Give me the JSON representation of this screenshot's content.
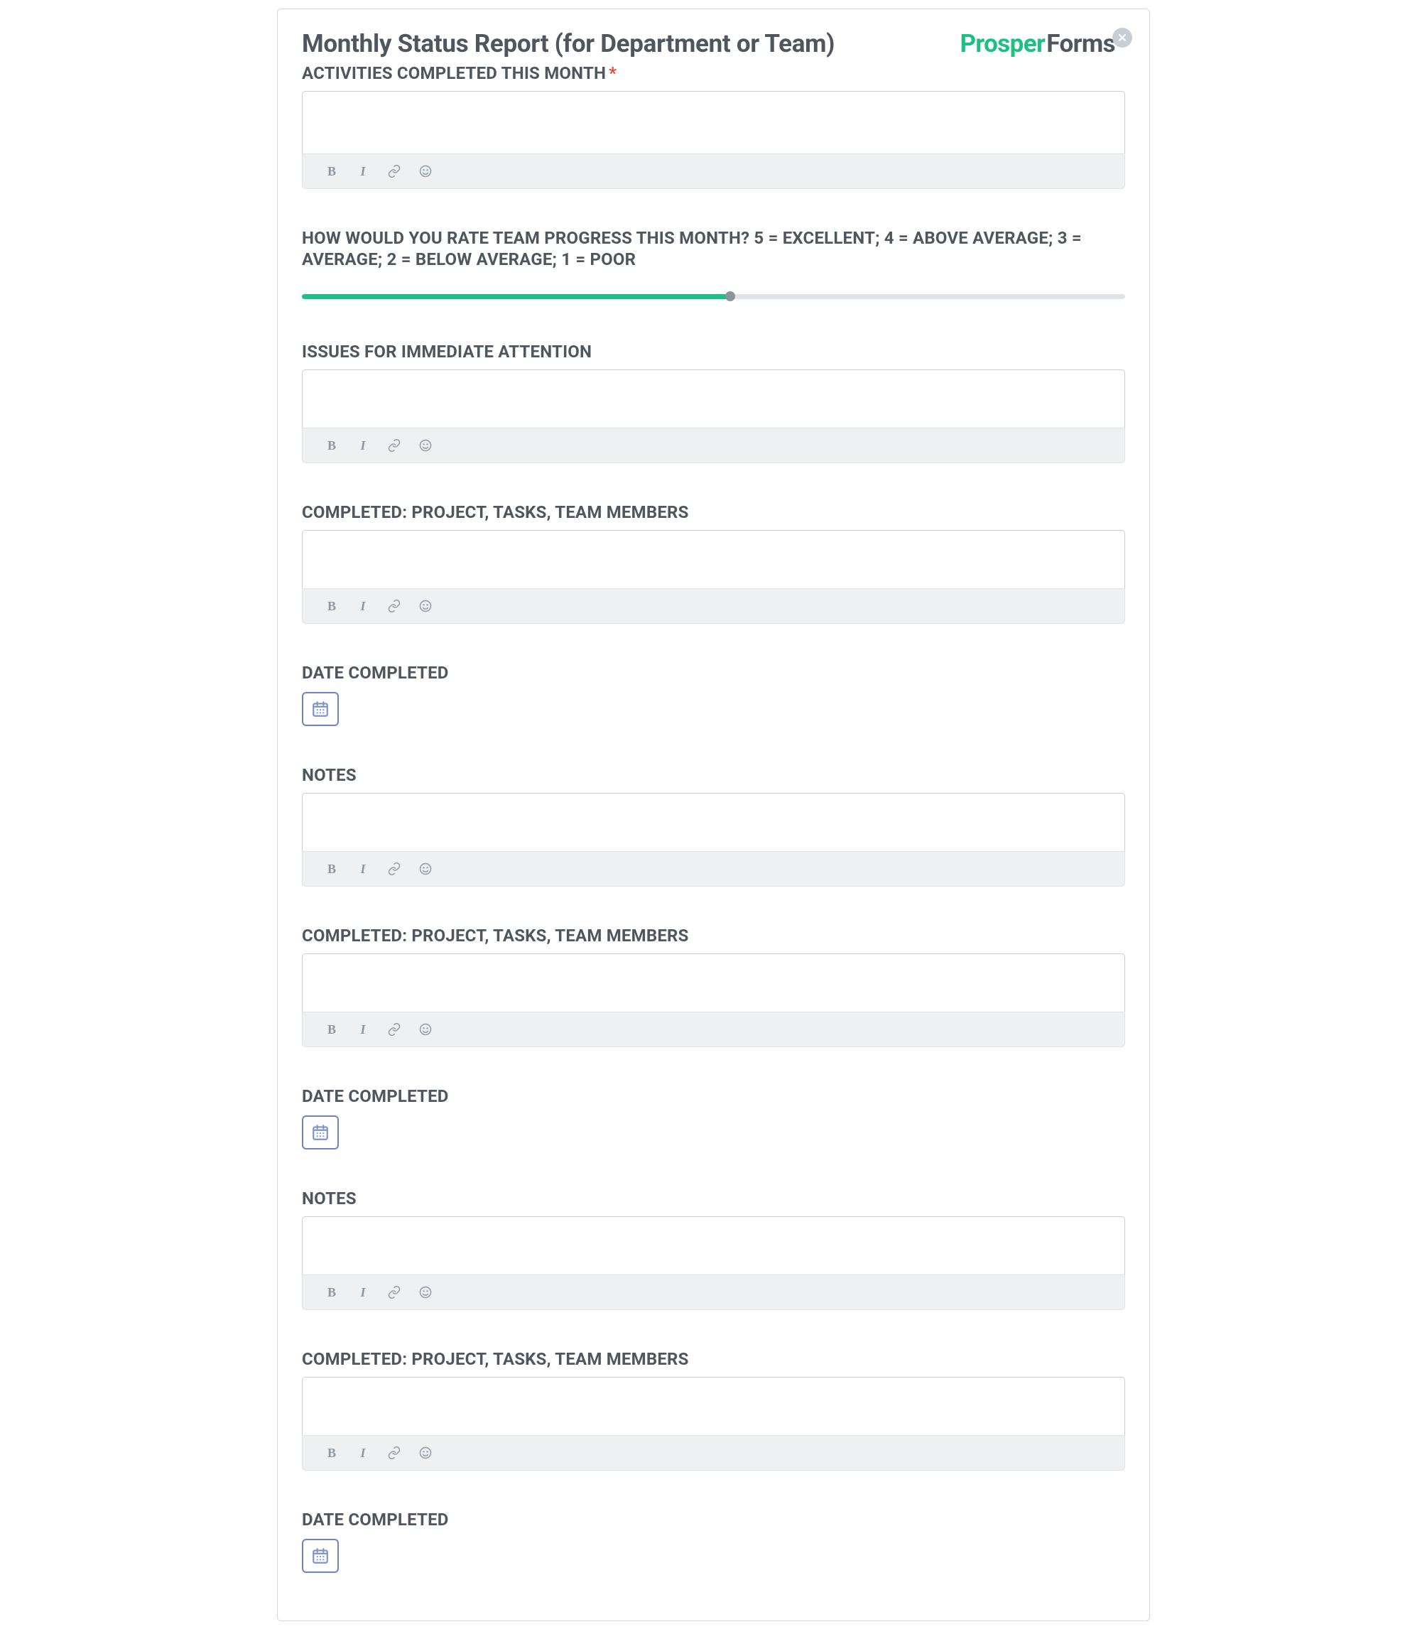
{
  "header": {
    "title": "Monthly Status Report (for Department or Team)",
    "logo_part1": "Prosper",
    "logo_part2": "Forms"
  },
  "slider": {
    "percent": 52
  },
  "sections": [
    {
      "label": "ACTIVITIES COMPLETED THIS MONTH",
      "required": true,
      "type": "rich"
    },
    {
      "label": "HOW WOULD YOU RATE TEAM PROGRESS THIS MONTH? 5 = EXCELLENT; 4 = ABOVE AVERAGE; 3 = AVERAGE; 2 = BELOW AVERAGE; 1 = POOR",
      "type": "slider"
    },
    {
      "label": "ISSUES FOR IMMEDIATE ATTENTION",
      "type": "rich"
    },
    {
      "label": "COMPLETED: PROJECT, TASKS, TEAM MEMBERS",
      "type": "rich"
    },
    {
      "label": "DATE COMPLETED",
      "type": "date"
    },
    {
      "label": "NOTES",
      "type": "rich"
    },
    {
      "label": "COMPLETED: PROJECT, TASKS, TEAM MEMBERS",
      "type": "rich"
    },
    {
      "label": "DATE COMPLETED",
      "type": "date"
    },
    {
      "label": "NOTES",
      "type": "rich"
    },
    {
      "label": "COMPLETED: PROJECT, TASKS, TEAM MEMBERS",
      "type": "rich"
    },
    {
      "label": "DATE COMPLETED",
      "type": "date"
    }
  ],
  "toolbar": {
    "bold": "B",
    "italic": "I"
  }
}
